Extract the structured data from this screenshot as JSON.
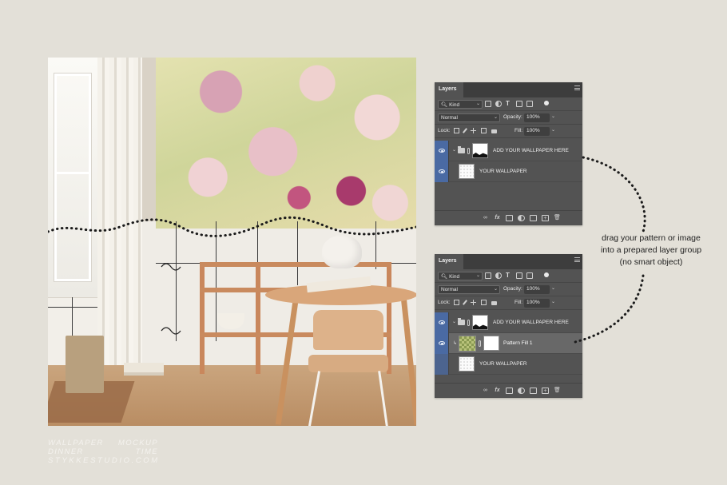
{
  "panels": [
    {
      "tab_label": "Layers",
      "filter": "Kind",
      "blend_mode": "Normal",
      "opacity_label": "Opacity:",
      "opacity": "100%",
      "lock_label": "Lock:",
      "fill_label": "Fill:",
      "fill": "100%",
      "layers": [
        {
          "name": "ADD YOUR WALLPAPER HERE",
          "type": "group",
          "visible": true
        },
        {
          "name": "YOUR WALLPAPER",
          "type": "layer",
          "visible": true
        }
      ]
    },
    {
      "tab_label": "Layers",
      "filter": "Kind",
      "blend_mode": "Normal",
      "opacity_label": "Opacity:",
      "opacity": "100%",
      "lock_label": "Lock:",
      "fill_label": "Fill:",
      "fill": "100%",
      "layers": [
        {
          "name": "ADD YOUR WALLPAPER HERE",
          "type": "group",
          "visible": true
        },
        {
          "name": "Pattern Fill 1",
          "type": "fill",
          "visible": true,
          "selected": true
        },
        {
          "name": "YOUR WALLPAPER",
          "type": "layer",
          "visible": false
        }
      ]
    }
  ],
  "annotation": {
    "line1": "drag your pattern or image",
    "line2": "into a prepared layer group",
    "line3": "(no smart object)"
  },
  "brand": {
    "word1": "WALLPAPER",
    "word2": "MOCKUP",
    "word3": "DINNER",
    "word4": "TIME",
    "site": "STYKKESTUDIO.COM"
  },
  "icons": {
    "bottom_bar": [
      "link-icon",
      "fx-icon",
      "mask-icon",
      "adjustment-icon",
      "folder-icon",
      "new-layer-icon",
      "trash-icon"
    ],
    "visibility": "eye-icon"
  },
  "colors": {
    "background": "#e3e0d8",
    "panel": "#535353",
    "eye_column": "#4a6aa3"
  }
}
